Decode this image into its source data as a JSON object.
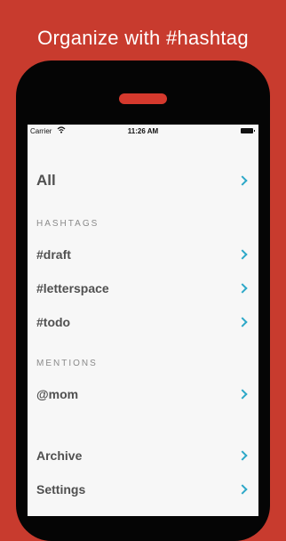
{
  "headline": "Organize with #hashtag",
  "status": {
    "carrier": "Carrier",
    "time": "11:26 AM"
  },
  "menu": {
    "all_label": "All",
    "hashtags_header": "HASHTAGS",
    "hashtags": [
      "#draft",
      "#letterspace",
      "#todo"
    ],
    "mentions_header": "MENTIONS",
    "mentions": [
      "@mom"
    ],
    "archive_label": "Archive",
    "settings_label": "Settings"
  },
  "colors": {
    "background": "#c83b2e",
    "accent": "#2da8c8",
    "speaker": "#d5392d"
  }
}
